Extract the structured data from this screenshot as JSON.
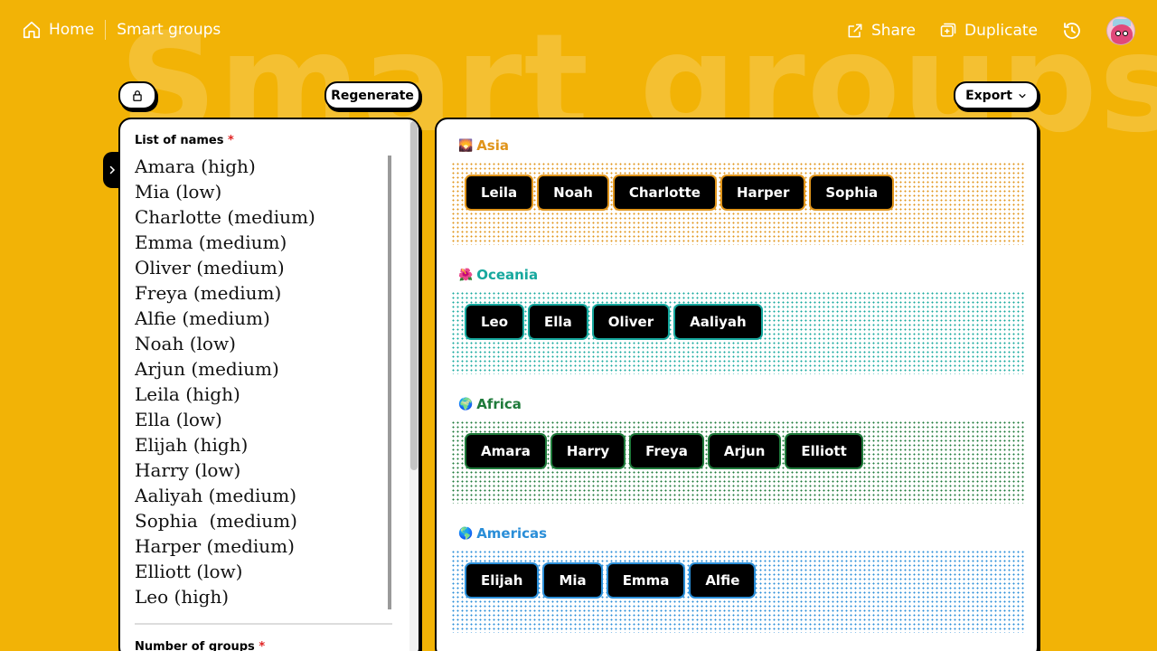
{
  "nav": {
    "home_label": "Home",
    "breadcrumb_label": "Smart groups",
    "share_label": "Share",
    "duplicate_label": "Duplicate"
  },
  "watermark": "Smart groups",
  "toolbar": {
    "regenerate_label": "Regenerate",
    "export_label": "Export"
  },
  "form": {
    "names_label": "List of names",
    "names_value": "Amara (high)\nMia (low)\nCharlotte (medium)\nEmma (medium)\nOliver (medium)\nFreya (medium)\nAlfie (medium)\nNoah (low)\nArjun (medium)\nLeila (high)\nElla (low)\nElijah (high)\nHarry (low)\nAaliyah (medium)\nSophia  (medium)\nHarper (medium)\nElliott (low)\nLeo (high)",
    "groups_label": "Number of groups",
    "required_mark": "*"
  },
  "groups": [
    {
      "icon": "🌄",
      "name": "Asia",
      "color": "#E0941A",
      "members": [
        "Leila",
        "Noah",
        "Charlotte",
        "Harper",
        "Sophia"
      ]
    },
    {
      "icon": "🌺",
      "name": "Oceania",
      "color": "#16A89E",
      "members": [
        "Leo",
        "Ella",
        "Oliver",
        "Aaliyah"
      ]
    },
    {
      "icon": "🌍",
      "name": "Africa",
      "color": "#1E7A3A",
      "members": [
        "Amara",
        "Harry",
        "Freya",
        "Arjun",
        "Elliott"
      ]
    },
    {
      "icon": "🌎",
      "name": "Americas",
      "color": "#2A8ED8",
      "members": [
        "Elijah",
        "Mia",
        "Emma",
        "Alfie"
      ]
    }
  ]
}
